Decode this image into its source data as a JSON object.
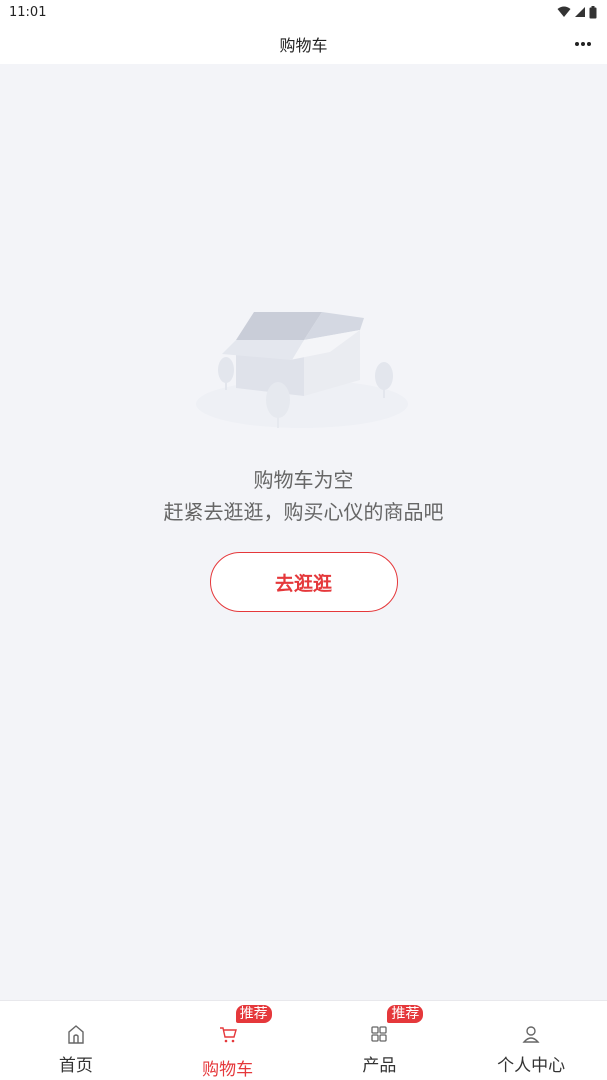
{
  "status_bar": {
    "time": "11:01"
  },
  "nav": {
    "title": "购物车"
  },
  "empty_state": {
    "title": "购物车为空",
    "subtitle": "赶紧去逛逛，购买心仪的商品吧",
    "button_label": "去逛逛"
  },
  "tabs": [
    {
      "label": "首页",
      "icon": "home-icon",
      "active": false,
      "badge": ""
    },
    {
      "label": "购物车",
      "icon": "cart-icon",
      "active": true,
      "badge": "推荐"
    },
    {
      "label": "产品",
      "icon": "grid-icon",
      "active": false,
      "badge": "推荐"
    },
    {
      "label": "个人中心",
      "icon": "user-icon",
      "active": false,
      "badge": ""
    }
  ],
  "colors": {
    "accent": "#e5383b",
    "background": "#f3f4f8"
  }
}
